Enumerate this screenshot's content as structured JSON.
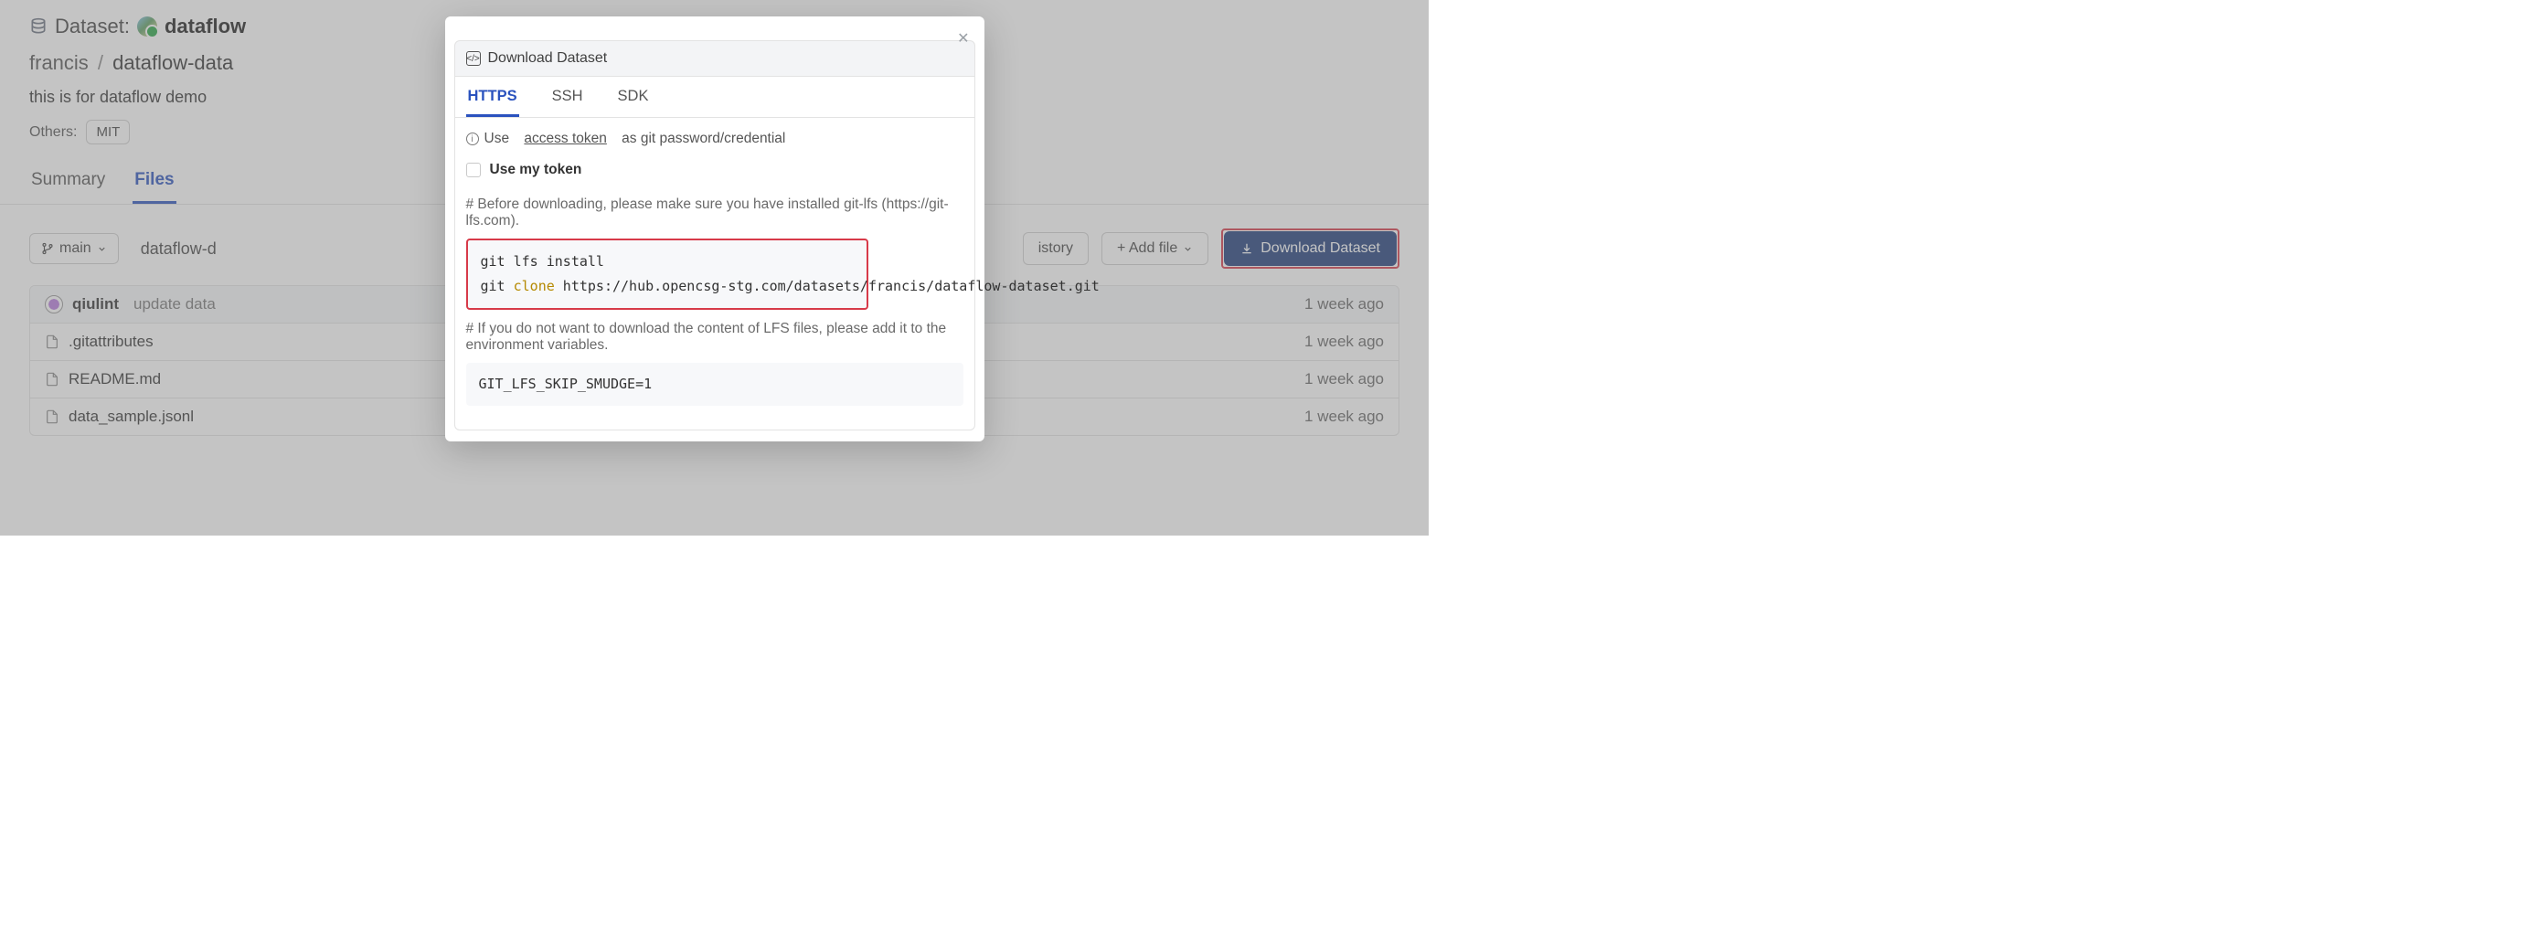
{
  "header": {
    "label": "Dataset:",
    "name_prefix": "dataflow"
  },
  "breadcrumb": {
    "owner": "francis",
    "name": "dataflow-data"
  },
  "description": "this is for dataflow demo",
  "others": {
    "label": "Others:",
    "tags": [
      "MIT"
    ]
  },
  "page_tabs": {
    "summary": "Summary",
    "files": "Files"
  },
  "file_toolbar": {
    "branch": "main",
    "path": "dataflow-d",
    "history": "istory",
    "add_file": "+ Add file",
    "download": "Download Dataset"
  },
  "files": {
    "commit": {
      "author": "qiulint",
      "message": "update data",
      "time": "1 week ago"
    },
    "rows": [
      {
        "name": ".gitattributes",
        "time": "1 week ago"
      },
      {
        "name": "README.md",
        "time": "1 week ago"
      },
      {
        "name": "data_sample.jsonl",
        "time": "1 week ago"
      }
    ]
  },
  "modal": {
    "title": "Download Dataset",
    "tabs": {
      "https": "HTTPS",
      "ssh": "SSH",
      "sdk": "SDK"
    },
    "info_pre": "Use",
    "info_link": "access token",
    "info_post": "as git password/credential",
    "use_token": "Use my token",
    "note1": "# Before downloading, please make sure you have installed git-lfs (https://git-lfs.com).",
    "code1_line1_a": "git lfs install",
    "code1_line2_a": "git ",
    "code1_line2_kw": "clone",
    "code1_line2_b": " https://hub.opencsg-stg.com/datasets/francis/dataflow-dataset.git",
    "note2": "# If you do not want to download the content of LFS files, please add it to the environment variables.",
    "code2": "GIT_LFS_SKIP_SMUDGE=1"
  }
}
